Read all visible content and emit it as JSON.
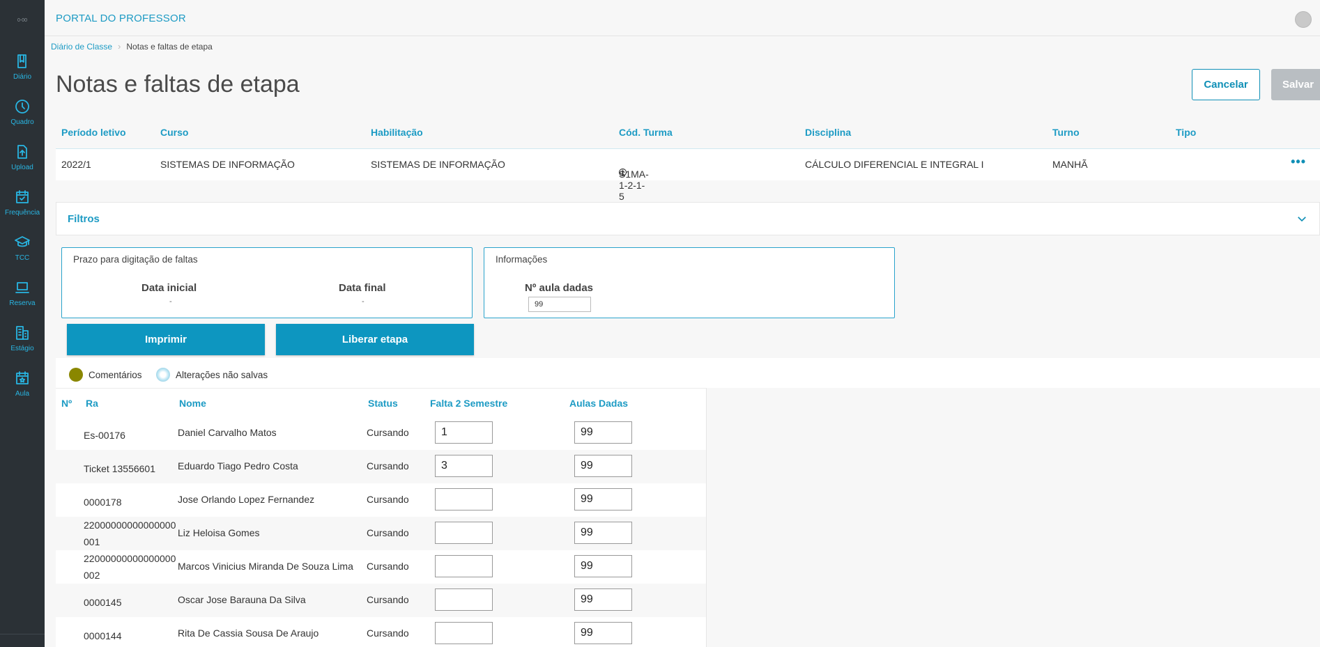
{
  "sidebar": {
    "logo_text": "0-00",
    "items": [
      {
        "label": "Diário",
        "icon": "book-icon"
      },
      {
        "label": "Quadro",
        "icon": "clock-icon"
      },
      {
        "label": "Upload",
        "icon": "upload-file-icon"
      },
      {
        "label": "Frequência",
        "icon": "calendar-check-icon"
      },
      {
        "label": "TCC",
        "icon": "graduation-cap-icon"
      },
      {
        "label": "Reserva",
        "icon": "laptop-icon"
      },
      {
        "label": "Estágio",
        "icon": "building-icon"
      },
      {
        "label": "Aula",
        "icon": "calendar-star-icon"
      }
    ]
  },
  "header": {
    "app_title": "PORTAL DO PROFESSOR"
  },
  "breadcrumb": {
    "link": "Diário de Classe",
    "current": "Notas e faltas de etapa"
  },
  "page": {
    "title": "Notas e faltas de etapa",
    "cancel_label": "Cancelar",
    "save_label": "Salvar"
  },
  "info_table": {
    "headers": {
      "periodo": "Período letivo",
      "curso": "Curso",
      "habilitacao": "Habilitação",
      "cod_turma": "Cód. Turma",
      "disciplina": "Disciplina",
      "turno": "Turno",
      "tipo": "Tipo"
    },
    "row": {
      "periodo": "2022/1",
      "curso": "SISTEMAS DE INFORMAÇÃO",
      "habilitacao": "SISTEMAS DE INFORMAÇÃO",
      "cod_turma": "S1MA-1-2-1-5",
      "disciplina": "CÁLCULO DIFERENCIAL E INTEGRAL I",
      "turno": "MANHÃ",
      "tipo": ""
    },
    "more_label": "•••"
  },
  "filtros": {
    "title": "Filtros"
  },
  "prazo": {
    "title": "Prazo para digitação de faltas",
    "data_inicial_label": "Data inicial",
    "data_inicial_value": "-",
    "data_final_label": "Data final",
    "data_final_value": "-"
  },
  "informacoes": {
    "title": "Informações",
    "aulas_label": "Nº aula dadas",
    "aulas_value": "99"
  },
  "actions": {
    "imprimir": "Imprimir",
    "liberar": "Liberar etapa"
  },
  "legend": {
    "comentarios": "Comentários",
    "nao_salvas": "Alterações não salvas"
  },
  "students_table": {
    "headers": {
      "num": "Nº",
      "ra": "Ra",
      "nome": "Nome",
      "status": "Status",
      "falta": "Falta 2 Semestre",
      "aulas": "Aulas Dadas"
    },
    "rows": [
      {
        "ra": "Es-00176",
        "nome": "Daniel Carvalho Matos",
        "status": "Cursando",
        "falta": "1",
        "aulas": "99"
      },
      {
        "ra": "Ticket 13556601",
        "nome": "Eduardo Tiago Pedro Costa",
        "status": "Cursando",
        "falta": "3",
        "aulas": "99"
      },
      {
        "ra": "0000178",
        "nome": "Jose Orlando Lopez Fernandez",
        "status": "Cursando",
        "falta": "",
        "aulas": "99"
      },
      {
        "ra": "22000000000000000001",
        "nome": "Liz Heloisa Gomes",
        "status": "Cursando",
        "falta": "",
        "aulas": "99"
      },
      {
        "ra": "22000000000000000002",
        "nome": "Marcos Vinicius Miranda De Souza Lima",
        "status": "Cursando",
        "falta": "",
        "aulas": "99"
      },
      {
        "ra": "0000145",
        "nome": "Oscar Jose Barauna Da Silva",
        "status": "Cursando",
        "falta": "",
        "aulas": "99"
      },
      {
        "ra": "0000144",
        "nome": "Rita De Cassia Sousa De Araujo",
        "status": "Cursando",
        "falta": "",
        "aulas": "99"
      }
    ]
  }
}
